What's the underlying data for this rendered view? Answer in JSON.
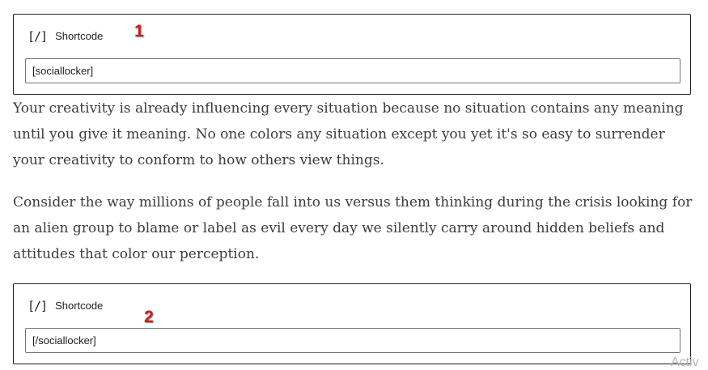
{
  "blocks": [
    {
      "icon": "shortcode-icon",
      "icon_glyph": "[/]",
      "title": "Shortcode",
      "value": "[sociallocker]"
    },
    {
      "icon": "shortcode-icon",
      "icon_glyph": "[/]",
      "title": "Shortcode",
      "value": "[/sociallocker]"
    }
  ],
  "annotations": [
    "1",
    "2"
  ],
  "annotation_color": "#d11a1a",
  "paragraphs": [
    "Your creativity is already influencing every situation because no situation contains any meaning until you give it meaning. No one colors any situation except you yet it's so easy to surrender your creativity to conform to how others view things.",
    "Consider the way millions of people fall into us versus them thinking during the crisis looking for an alien group to blame or label as evil every day we silently carry around hidden beliefs and attitudes that color our perception."
  ],
  "watermark": "Activ"
}
